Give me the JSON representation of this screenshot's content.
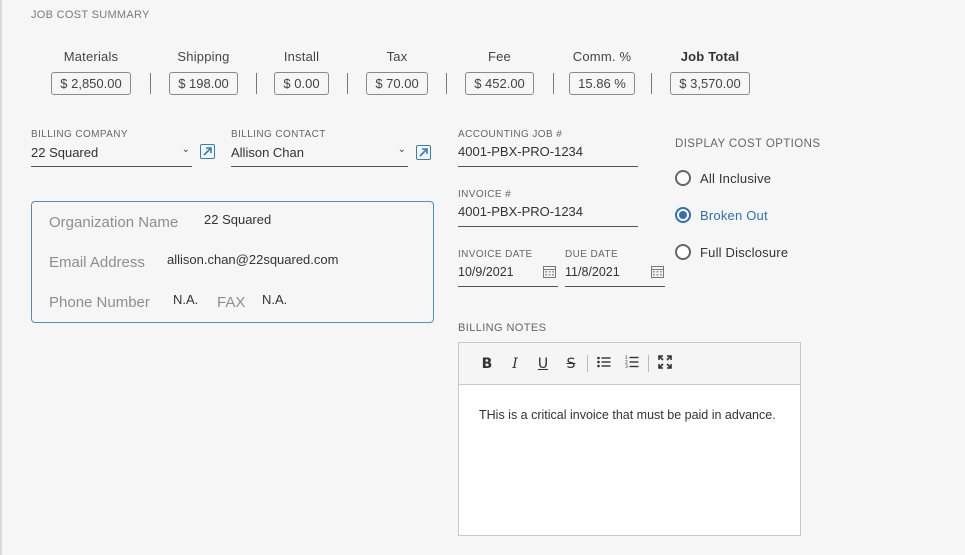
{
  "section": {
    "title": "JOB COST SUMMARY"
  },
  "costs": [
    {
      "label": "Materials",
      "value": "$ 2,850.00"
    },
    {
      "label": "Shipping",
      "value": "$ 198.00"
    },
    {
      "label": "Install",
      "value": "$ 0.00"
    },
    {
      "label": "Tax",
      "value": "$ 70.00"
    },
    {
      "label": "Fee",
      "value": "$ 452.00"
    },
    {
      "label": "Comm. %",
      "value": "15.86 %"
    },
    {
      "label": "Job Total",
      "value": "$ 3,570.00"
    }
  ],
  "billing_company": {
    "label": "BILLING COMPANY",
    "value": "22 Squared"
  },
  "billing_contact": {
    "label": "BILLING CONTACT",
    "value": "Allison Chan"
  },
  "contact_card": {
    "org_label": "Organization Name",
    "org_value": "22 Squared",
    "email_label": "Email Address",
    "email_value": "allison.chan@22squared.com",
    "phone_label": "Phone Number",
    "phone_value": "N.A.",
    "fax_label": "FAX",
    "fax_value": "N.A."
  },
  "accounting_job": {
    "label": "ACCOUNTING JOB #",
    "value": "4001-PBX-PRO-1234"
  },
  "invoice": {
    "label": "INVOICE #",
    "value": "4001-PBX-PRO-1234"
  },
  "invoice_date": {
    "label": "INVOICE DATE",
    "value": "10/9/2021"
  },
  "due_date": {
    "label": "DUE DATE",
    "value": "11/8/2021"
  },
  "display_options": {
    "title": "DISPLAY COST OPTIONS",
    "options": [
      {
        "label": "All Inclusive",
        "checked": false
      },
      {
        "label": "Broken Out",
        "checked": true
      },
      {
        "label": "Full Disclosure",
        "checked": false
      }
    ]
  },
  "billing_notes": {
    "label": "BILLING NOTES",
    "toolbar": {
      "bold": "B",
      "italic": "I",
      "underline": "U",
      "strike": "S"
    },
    "text": "THis is a critical invoice that must be paid in advance."
  },
  "colors": {
    "accent": "#2f6fb3",
    "card_border": "#4a8fcc"
  }
}
